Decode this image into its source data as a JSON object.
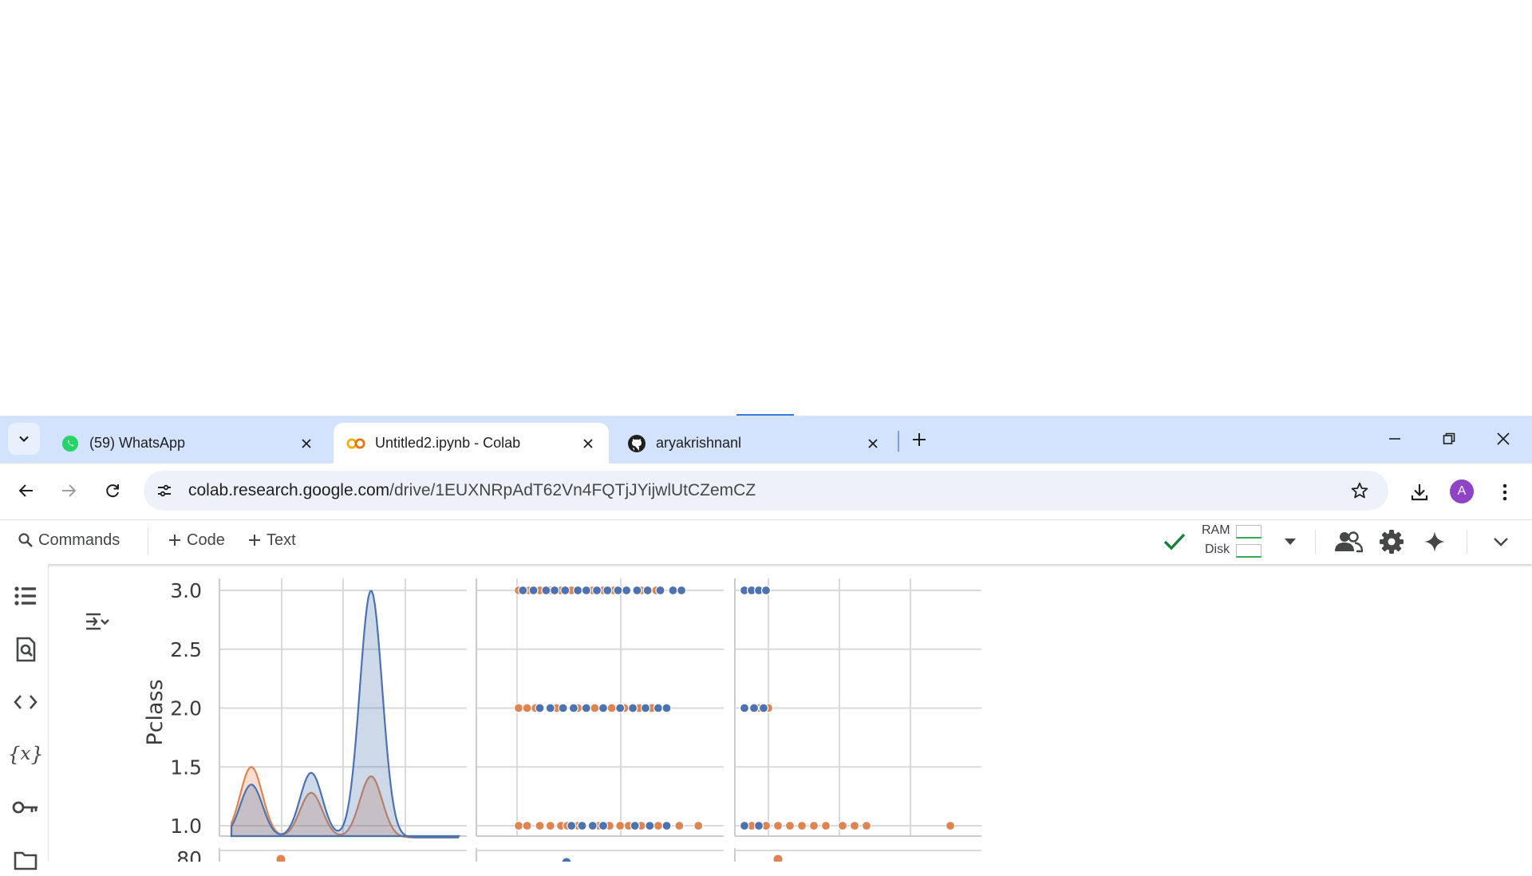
{
  "browser": {
    "tabs": [
      {
        "title": "(59) WhatsApp",
        "icon": "whatsapp-icon",
        "active": false
      },
      {
        "title": "Untitled2.ipynb - Colab",
        "icon": "colab-icon",
        "active": true
      },
      {
        "title": "aryakrishnanl",
        "icon": "github-icon",
        "active": false
      }
    ],
    "url_host": "colab.research.google.com",
    "url_path": "/drive/1EUXNRpAdT62Vn4FQTjJYijwlUtCZemCZ",
    "profile_initial": "A"
  },
  "colab": {
    "toolbar": {
      "commands_label": "Commands",
      "add_code_label": "Code",
      "add_text_label": "Text",
      "ram_label": "RAM",
      "disk_label": "Disk"
    },
    "sidebar_icons": [
      "table-of-contents-icon",
      "find-icon",
      "code-snippets-icon",
      "variables-icon",
      "secrets-key-icon",
      "files-folder-icon"
    ]
  },
  "colors": {
    "series_blue": "#4c72b0",
    "series_orange": "#dd8452",
    "tabstrip": "#d3e3fd",
    "connected_check": "#188038"
  },
  "chart_data": {
    "type": "scatter",
    "description_panels": [
      "kde",
      "scatter",
      "scatter"
    ],
    "ylabel": "Pclass",
    "ytick_labels": [
      "1.0",
      "1.5",
      "2.0",
      "2.5",
      "3.0"
    ],
    "ylim": [
      0.9,
      3.0
    ],
    "next_row_ytick_label": "80",
    "grid": true,
    "series": [
      {
        "color": "#4c72b0"
      },
      {
        "color": "#dd8452"
      }
    ],
    "kde_panel": {
      "series": [
        {
          "color": "#4c72b0",
          "peaks": [
            {
              "x_rel": 0.25,
              "height": 1.35
            },
            {
              "x_rel": 0.5,
              "height": 1.45
            },
            {
              "x_rel": 0.75,
              "height": 3.0
            }
          ]
        },
        {
          "color": "#dd8452",
          "peaks": [
            {
              "x_rel": 0.25,
              "height": 1.5
            },
            {
              "x_rel": 0.5,
              "height": 1.28
            },
            {
              "x_rel": 0.75,
              "height": 1.42
            }
          ]
        }
      ]
    },
    "scatter_panel_2": {
      "rows": [
        {
          "y": 3.0,
          "blue_x": [
            0.22,
            0.27,
            0.33,
            0.37,
            0.42,
            0.48,
            0.52,
            0.57,
            0.62,
            0.67,
            0.71,
            0.76,
            0.81,
            0.87,
            0.93,
            0.97
          ],
          "orange_x": [
            0.2,
            0.25,
            0.3,
            0.35,
            0.4,
            0.45,
            0.55,
            0.6,
            0.65,
            0.7,
            0.78,
            0.85
          ]
        },
        {
          "y": 2.0,
          "blue_x": [
            0.3,
            0.35,
            0.41,
            0.46,
            0.52,
            0.6,
            0.68,
            0.74,
            0.8,
            0.86,
            0.9
          ],
          "orange_x": [
            0.2,
            0.24,
            0.28,
            0.38,
            0.48,
            0.56,
            0.64,
            0.7,
            0.77,
            0.83
          ]
        },
        {
          "y": 1.0,
          "blue_x": [
            0.45,
            0.5,
            0.55,
            0.6,
            0.75,
            0.82,
            0.9
          ],
          "orange_x": [
            0.2,
            0.24,
            0.3,
            0.35,
            0.4,
            0.43,
            0.48,
            0.58,
            0.63,
            0.68,
            0.72,
            0.78,
            0.86,
            0.96,
            1.05
          ]
        }
      ]
    },
    "scatter_panel_3": {
      "rows": [
        {
          "y": 3.0,
          "blue_x": [
            0.04,
            0.07,
            0.1,
            0.13
          ],
          "orange_x": [
            0.06,
            0.11
          ]
        },
        {
          "y": 2.0,
          "blue_x": [
            0.04,
            0.08,
            0.12
          ],
          "orange_x": [
            0.1,
            0.14
          ]
        },
        {
          "y": 1.0,
          "blue_x": [
            0.04,
            0.1
          ],
          "orange_x": [
            0.07,
            0.13,
            0.18,
            0.23,
            0.28,
            0.33,
            0.38,
            0.45,
            0.5,
            0.55,
            0.9
          ]
        }
      ]
    }
  }
}
